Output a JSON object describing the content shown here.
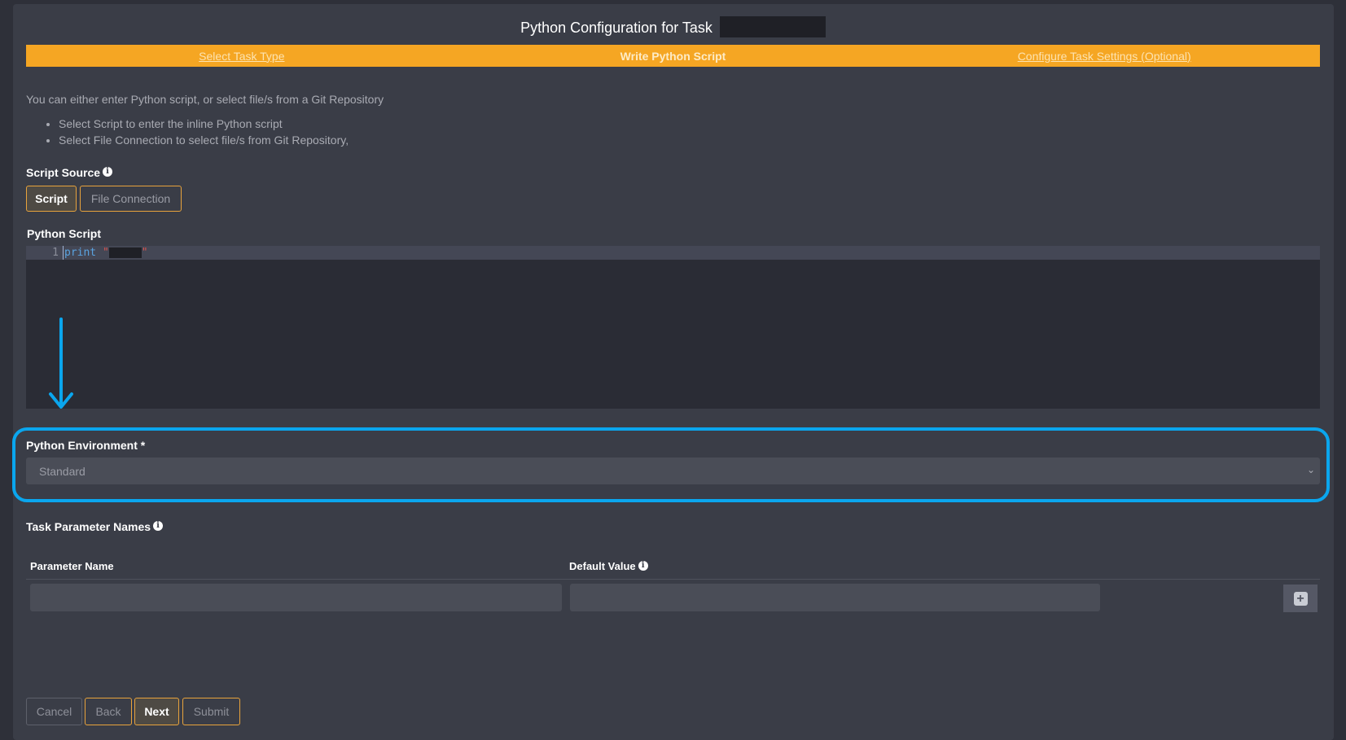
{
  "header": {
    "title": "Python Configuration for Task"
  },
  "steps": [
    {
      "label": "Select Task Type",
      "state": "link"
    },
    {
      "label": "Write Python Script",
      "state": "active"
    },
    {
      "label": "Configure Task Settings (Optional)",
      "state": "link"
    }
  ],
  "intro": {
    "text": "You can either enter Python script, or select file/s from a Git Repository",
    "bullets": [
      "Select Script to enter the inline Python script",
      "Select File Connection to select file/s from Git Repository,"
    ]
  },
  "script_source": {
    "label": "Script Source",
    "options": [
      "Script",
      "File Connection"
    ],
    "selected": "Script"
  },
  "python_script": {
    "label": "Python Script",
    "lines": [
      {
        "number": "1",
        "keyword": "print",
        "string_open": "\"",
        "string_close": "\""
      }
    ]
  },
  "environment": {
    "label": "Python Environment *",
    "value": "Standard"
  },
  "parameters": {
    "label": "Task Parameter Names",
    "columns": [
      "Parameter Name",
      "Default Value"
    ],
    "rows": [
      {
        "name": "",
        "default": ""
      }
    ]
  },
  "footer": {
    "cancel": "Cancel",
    "back": "Back",
    "next": "Next",
    "submit": "Submit"
  },
  "colors": {
    "accent": "#f5a623",
    "highlight": "#0aa6ee",
    "background": "#3a3d47"
  }
}
